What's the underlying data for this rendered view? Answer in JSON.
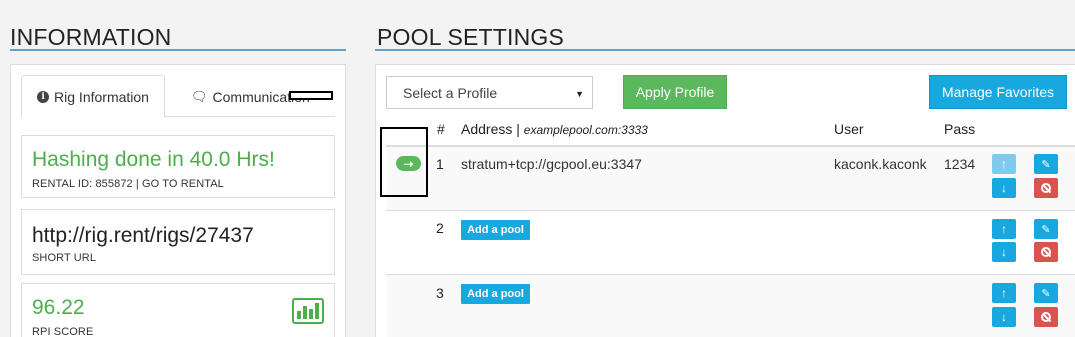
{
  "information": {
    "title": "INFORMATION",
    "tabs": [
      {
        "label": "Rig Information",
        "icon": "info-circle-icon",
        "active": true
      },
      {
        "label": "Communication",
        "icon": "chat-bubble-icon",
        "active": false
      }
    ],
    "status": {
      "text": "Hashing done in 40.0 Hrs!",
      "sub": "RENTAL ID: 855872 | GO TO RENTAL"
    },
    "short_url": {
      "text": "http://rig.rent/rigs/27437",
      "sub": "SHORT URL"
    },
    "rpi": {
      "text": "96.22",
      "sub": "RPI SCORE",
      "icon": "bar-chart-icon"
    }
  },
  "pool_settings": {
    "title": "POOL SETTINGS",
    "profile_select": {
      "placeholder": "Select a Profile"
    },
    "apply_label": "Apply Profile",
    "manage_label": "Manage Favorites",
    "columns": {
      "num": "#",
      "address": "Address |",
      "address_example": "examplepool.com:3333",
      "user": "User",
      "pass": "Pass"
    },
    "rows": [
      {
        "num": "1",
        "address": "stratum+tcp://gcpool.eu:3347",
        "user": "kaconk.kaconk",
        "pass": "1234",
        "active": true
      },
      {
        "num": "2",
        "add_label": "Add a pool"
      },
      {
        "num": "3",
        "add_label": "Add a pool"
      }
    ]
  },
  "colors": {
    "accent_blue": "#17a8e0",
    "success_green": "#5cb85c",
    "danger_red": "#d9534f"
  }
}
